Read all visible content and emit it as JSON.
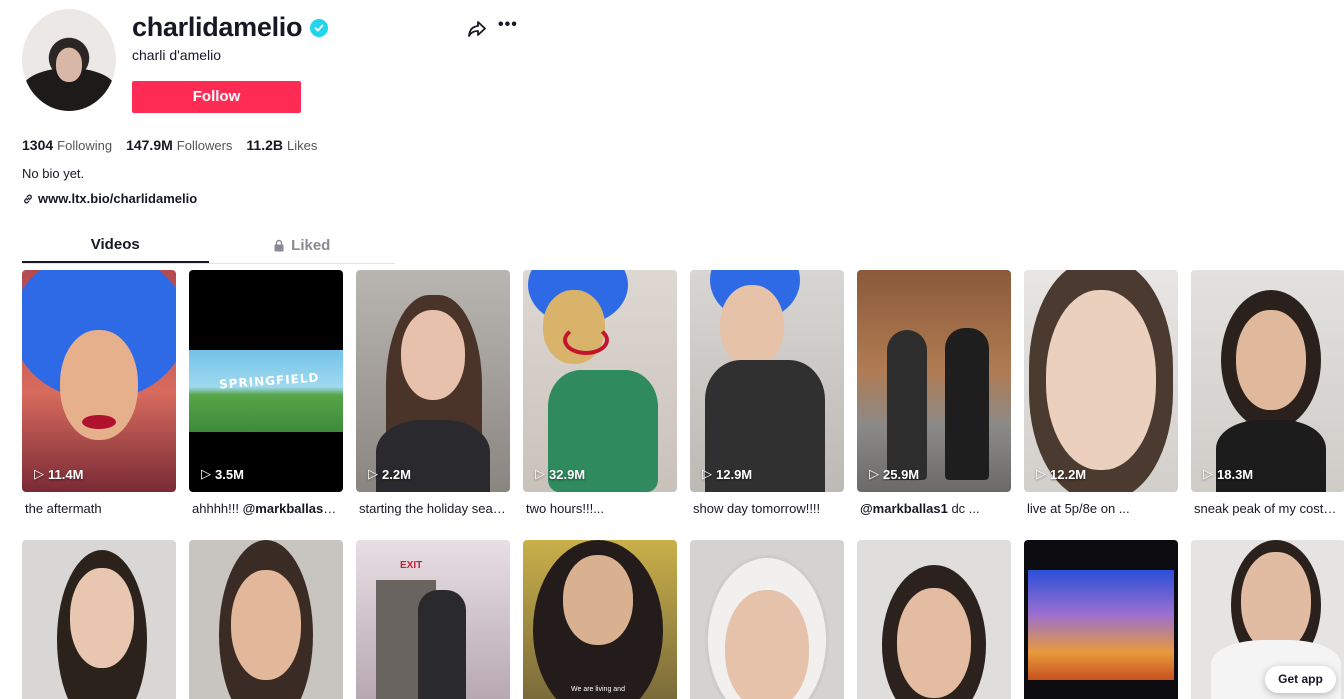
{
  "profile": {
    "username": "charlidamelio",
    "nickname": "charli d'amelio",
    "follow_label": "Follow",
    "stats": [
      {
        "value": "1304",
        "label": "Following"
      },
      {
        "value": "147.9M",
        "label": "Followers"
      },
      {
        "value": "11.2B",
        "label": "Likes"
      }
    ],
    "bio": "No bio yet.",
    "link": "www.ltx.bio/charlidamelio"
  },
  "tabs": [
    {
      "label": "Videos",
      "active": true
    },
    {
      "label": "Liked",
      "active": false,
      "icon": "lock-icon"
    }
  ],
  "videos_row1": [
    {
      "views": "11.4M",
      "caption": "the aftermath",
      "mention": ""
    },
    {
      "views": "3.5M",
      "caption": "ahhhh!!! ",
      "mention": "@markballas1 ..."
    },
    {
      "views": "2.2M",
      "caption": "starting the holiday seas...",
      "mention": ""
    },
    {
      "views": "32.9M",
      "caption": "two hours!!!...",
      "mention": ""
    },
    {
      "views": "12.9M",
      "caption": "show day tomorrow!!!!",
      "mention": ""
    },
    {
      "views": "25.9M",
      "caption": " dc ...",
      "mention_first": "@markballas1"
    },
    {
      "views": "12.2M",
      "caption": "live at 5p/8e on ...",
      "mention": ""
    },
    {
      "views": "18.3M",
      "caption": "sneak peak of my costu...",
      "mention": ""
    }
  ],
  "thumb_text": {
    "springfield": "SPRINGFIELD",
    "exit": "EXIT",
    "overlay": "We are living and"
  },
  "get_app_label": "Get app",
  "colors": {
    "accent": "#fe2c55",
    "verified": "#20d5ec"
  }
}
